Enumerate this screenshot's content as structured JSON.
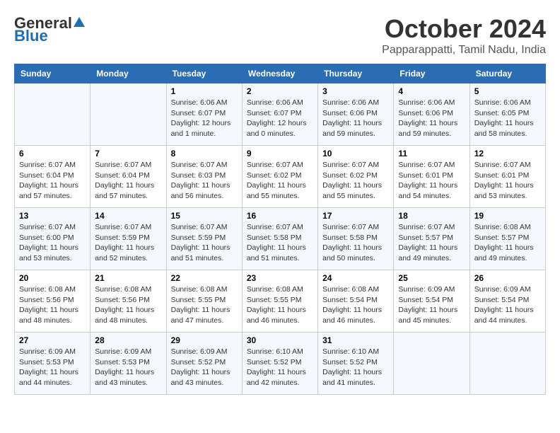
{
  "logo": {
    "general": "General",
    "blue": "Blue"
  },
  "title": "October 2024",
  "location": "Papparappatti, Tamil Nadu, India",
  "days_header": [
    "Sunday",
    "Monday",
    "Tuesday",
    "Wednesday",
    "Thursday",
    "Friday",
    "Saturday"
  ],
  "weeks": [
    [
      {
        "day": "",
        "info": ""
      },
      {
        "day": "",
        "info": ""
      },
      {
        "day": "1",
        "info": "Sunrise: 6:06 AM\nSunset: 6:07 PM\nDaylight: 12 hours\nand 1 minute."
      },
      {
        "day": "2",
        "info": "Sunrise: 6:06 AM\nSunset: 6:07 PM\nDaylight: 12 hours\nand 0 minutes."
      },
      {
        "day": "3",
        "info": "Sunrise: 6:06 AM\nSunset: 6:06 PM\nDaylight: 11 hours\nand 59 minutes."
      },
      {
        "day": "4",
        "info": "Sunrise: 6:06 AM\nSunset: 6:06 PM\nDaylight: 11 hours\nand 59 minutes."
      },
      {
        "day": "5",
        "info": "Sunrise: 6:06 AM\nSunset: 6:05 PM\nDaylight: 11 hours\nand 58 minutes."
      }
    ],
    [
      {
        "day": "6",
        "info": "Sunrise: 6:07 AM\nSunset: 6:04 PM\nDaylight: 11 hours\nand 57 minutes."
      },
      {
        "day": "7",
        "info": "Sunrise: 6:07 AM\nSunset: 6:04 PM\nDaylight: 11 hours\nand 57 minutes."
      },
      {
        "day": "8",
        "info": "Sunrise: 6:07 AM\nSunset: 6:03 PM\nDaylight: 11 hours\nand 56 minutes."
      },
      {
        "day": "9",
        "info": "Sunrise: 6:07 AM\nSunset: 6:02 PM\nDaylight: 11 hours\nand 55 minutes."
      },
      {
        "day": "10",
        "info": "Sunrise: 6:07 AM\nSunset: 6:02 PM\nDaylight: 11 hours\nand 55 minutes."
      },
      {
        "day": "11",
        "info": "Sunrise: 6:07 AM\nSunset: 6:01 PM\nDaylight: 11 hours\nand 54 minutes."
      },
      {
        "day": "12",
        "info": "Sunrise: 6:07 AM\nSunset: 6:01 PM\nDaylight: 11 hours\nand 53 minutes."
      }
    ],
    [
      {
        "day": "13",
        "info": "Sunrise: 6:07 AM\nSunset: 6:00 PM\nDaylight: 11 hours\nand 53 minutes."
      },
      {
        "day": "14",
        "info": "Sunrise: 6:07 AM\nSunset: 5:59 PM\nDaylight: 11 hours\nand 52 minutes."
      },
      {
        "day": "15",
        "info": "Sunrise: 6:07 AM\nSunset: 5:59 PM\nDaylight: 11 hours\nand 51 minutes."
      },
      {
        "day": "16",
        "info": "Sunrise: 6:07 AM\nSunset: 5:58 PM\nDaylight: 11 hours\nand 51 minutes."
      },
      {
        "day": "17",
        "info": "Sunrise: 6:07 AM\nSunset: 5:58 PM\nDaylight: 11 hours\nand 50 minutes."
      },
      {
        "day": "18",
        "info": "Sunrise: 6:07 AM\nSunset: 5:57 PM\nDaylight: 11 hours\nand 49 minutes."
      },
      {
        "day": "19",
        "info": "Sunrise: 6:08 AM\nSunset: 5:57 PM\nDaylight: 11 hours\nand 49 minutes."
      }
    ],
    [
      {
        "day": "20",
        "info": "Sunrise: 6:08 AM\nSunset: 5:56 PM\nDaylight: 11 hours\nand 48 minutes."
      },
      {
        "day": "21",
        "info": "Sunrise: 6:08 AM\nSunset: 5:56 PM\nDaylight: 11 hours\nand 48 minutes."
      },
      {
        "day": "22",
        "info": "Sunrise: 6:08 AM\nSunset: 5:55 PM\nDaylight: 11 hours\nand 47 minutes."
      },
      {
        "day": "23",
        "info": "Sunrise: 6:08 AM\nSunset: 5:55 PM\nDaylight: 11 hours\nand 46 minutes."
      },
      {
        "day": "24",
        "info": "Sunrise: 6:08 AM\nSunset: 5:54 PM\nDaylight: 11 hours\nand 46 minutes."
      },
      {
        "day": "25",
        "info": "Sunrise: 6:09 AM\nSunset: 5:54 PM\nDaylight: 11 hours\nand 45 minutes."
      },
      {
        "day": "26",
        "info": "Sunrise: 6:09 AM\nSunset: 5:54 PM\nDaylight: 11 hours\nand 44 minutes."
      }
    ],
    [
      {
        "day": "27",
        "info": "Sunrise: 6:09 AM\nSunset: 5:53 PM\nDaylight: 11 hours\nand 44 minutes."
      },
      {
        "day": "28",
        "info": "Sunrise: 6:09 AM\nSunset: 5:53 PM\nDaylight: 11 hours\nand 43 minutes."
      },
      {
        "day": "29",
        "info": "Sunrise: 6:09 AM\nSunset: 5:52 PM\nDaylight: 11 hours\nand 43 minutes."
      },
      {
        "day": "30",
        "info": "Sunrise: 6:10 AM\nSunset: 5:52 PM\nDaylight: 11 hours\nand 42 minutes."
      },
      {
        "day": "31",
        "info": "Sunrise: 6:10 AM\nSunset: 5:52 PM\nDaylight: 11 hours\nand 41 minutes."
      },
      {
        "day": "",
        "info": ""
      },
      {
        "day": "",
        "info": ""
      }
    ]
  ]
}
